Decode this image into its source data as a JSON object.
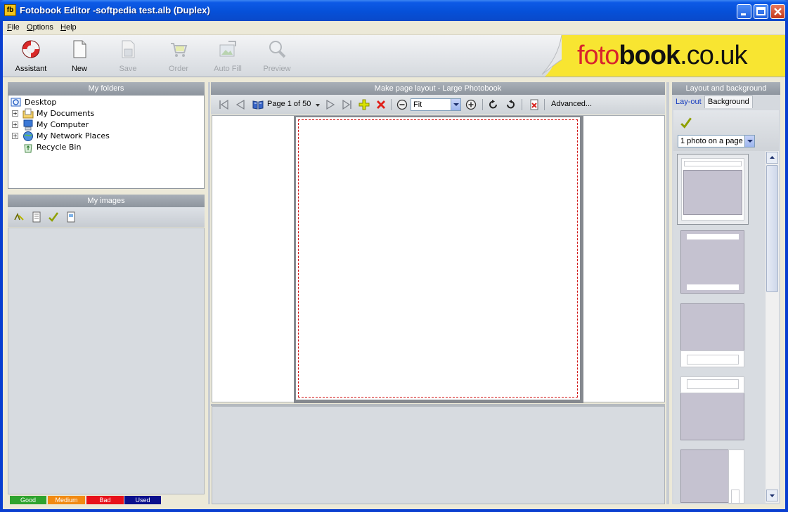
{
  "window": {
    "title": "Fotobook Editor -softpedia test.alb (Duplex)",
    "logo_text": "fb",
    "min_glyph": "_",
    "max_glyph": "□",
    "close_glyph": "✕"
  },
  "menu": {
    "items": [
      {
        "label": "File",
        "accel": "F",
        "rest": "ile"
      },
      {
        "label": "Options",
        "accel": "O",
        "rest": "ptions"
      },
      {
        "label": "Help",
        "accel": "H",
        "rest": "elp"
      }
    ]
  },
  "toolbar": {
    "buttons": [
      {
        "label": "Assistant",
        "icon": "lifebuoy-icon",
        "enabled": true
      },
      {
        "label": "New",
        "icon": "new-page-icon",
        "enabled": true
      },
      {
        "label": "Save",
        "icon": "save-icon",
        "enabled": false
      },
      {
        "label": "Order",
        "icon": "cart-icon",
        "enabled": false
      },
      {
        "label": "Auto Fill",
        "icon": "autofill-icon",
        "enabled": false
      },
      {
        "label": "Preview",
        "icon": "magnifier-icon",
        "enabled": false
      }
    ],
    "brand": {
      "part1": "foto",
      "part2": "book",
      "part3": ".co.uk"
    }
  },
  "folders": {
    "header": "My folders",
    "items": [
      {
        "label": "Desktop",
        "icon": "desktop-icon",
        "expandable": false
      },
      {
        "label": "My Documents",
        "icon": "documents-icon",
        "expandable": true
      },
      {
        "label": "My Computer",
        "icon": "computer-icon",
        "expandable": true
      },
      {
        "label": "My Network Places",
        "icon": "network-icon",
        "expandable": true
      },
      {
        "label": "Recycle Bin",
        "icon": "recycle-bin-icon",
        "expandable": false
      }
    ],
    "expand_glyph": "+"
  },
  "images": {
    "header": "My images",
    "legend": [
      {
        "label": "Good",
        "color": "#2ea32e"
      },
      {
        "label": "Medium",
        "color": "#f28a12"
      },
      {
        "label": "Bad",
        "color": "#e8111a"
      },
      {
        "label": "Used",
        "color": "#0a0f8c"
      }
    ]
  },
  "layout": {
    "header": "Make page layout - Large Photobook",
    "page_label": "Page 1 of 50",
    "zoom_value": "Fit",
    "advanced_label": "Advanced..."
  },
  "right_panel": {
    "header": "Layout and background",
    "tabs": [
      {
        "label": "Lay-out",
        "active": true
      },
      {
        "label": "Background",
        "active": false
      }
    ],
    "photos_per_page": "1 photo on a page"
  },
  "colors": {
    "accent_red": "#d8242c",
    "banner_yellow": "#f8e531",
    "link_blue": "#1b3fbf"
  }
}
